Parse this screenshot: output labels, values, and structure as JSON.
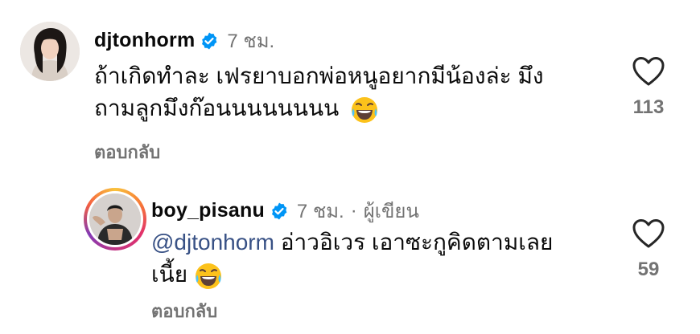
{
  "comments": [
    {
      "username": "djtonhorm",
      "time": "7 ชม.",
      "text_line1": "ถ้าเกิดทำละ เฟรยาบอกพ่อหนูอยากมีน้องล่ะ มึง",
      "text_line2": "ถามลูกมึงก๊อนนนนนนนน",
      "emoji": "laughing-tears",
      "likes": "113",
      "reply_label": "ตอบกลับ"
    },
    {
      "username": "boy_pisanu",
      "time": "7 ชม.",
      "author_label": "ผู้เขียน",
      "mention": "@djtonhorm",
      "text_line1": " อ่าวอิเวร เอาซะกูคิดตามเลย",
      "text_line2": "เนี้ย",
      "emoji": "laughing-tears",
      "likes": "59",
      "reply_label": "ตอบกลับ"
    }
  ],
  "colors": {
    "verified": "#0095f6",
    "meta_text": "#737373",
    "mention": "#385185"
  },
  "icons": [
    "verified-badge-icon",
    "heart-icon",
    "laughing-tears-emoji"
  ]
}
